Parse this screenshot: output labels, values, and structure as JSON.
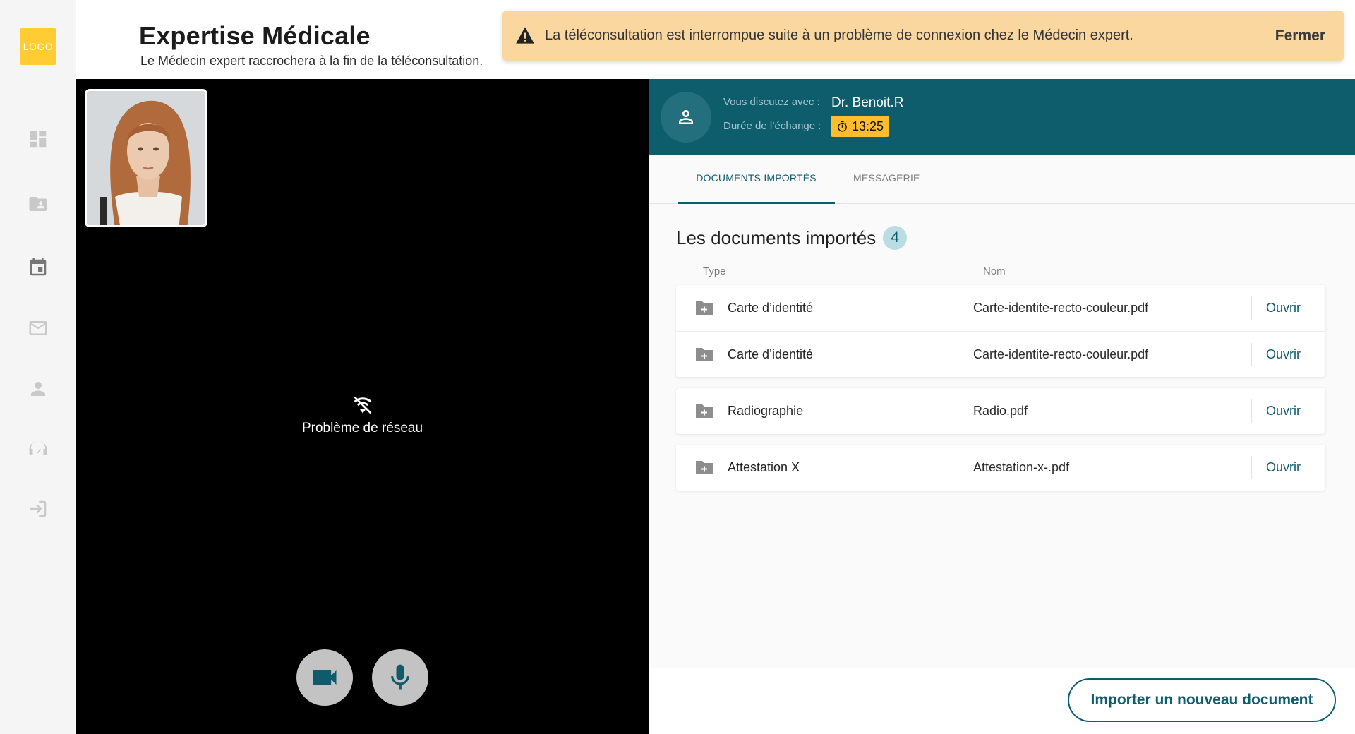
{
  "sidebar": {
    "logo_text": "LOGO",
    "items": [
      {
        "icon": "dashboard-icon"
      },
      {
        "icon": "folder-user-icon"
      },
      {
        "icon": "calendar-icon"
      },
      {
        "icon": "mail-icon"
      },
      {
        "icon": "person-icon"
      },
      {
        "icon": "support-icon"
      },
      {
        "icon": "logout-icon"
      }
    ]
  },
  "header": {
    "title": "Expertise Médicale",
    "subtitle": "Le Médecin expert raccrochera à la fin de la téléconsultation."
  },
  "alert": {
    "message": "La téléconsultation est interrompue suite à un problème de connexion chez le Médecin expert.",
    "close_label": "Fermer",
    "color": "#fbd7a0"
  },
  "video": {
    "status": "Problème de réseau"
  },
  "chat": {
    "with_label": "Vous discutez avec :",
    "doctor": "Dr. Benoit.R",
    "duration_label": "Durée de l’échange :",
    "duration": "13:25"
  },
  "tabs": [
    {
      "label": "DOCUMENTS IMPORTÉS",
      "active": true
    },
    {
      "label": "MESSAGERIE",
      "active": false
    }
  ],
  "documents": {
    "title": "Les documents importés",
    "count": "4",
    "columns": {
      "type": "Type",
      "name": "Nom"
    },
    "open_label": "Ouvrir",
    "groups": [
      [
        {
          "type": "Carte d’identité",
          "name": "Carte-identite-recto-couleur.pdf"
        },
        {
          "type": "Carte d’identité",
          "name": "Carte-identite-recto-couleur.pdf"
        }
      ],
      [
        {
          "type": "Radiographie",
          "name": "Radio.pdf"
        }
      ],
      [
        {
          "type": "Attestation X",
          "name": "Attestation-x-.pdf"
        }
      ]
    ]
  },
  "footer": {
    "import_label": "Importer un nouveau document"
  },
  "colors": {
    "primary": "#0e5d6d",
    "timer": "#fdbd2d",
    "logo": "#ffcc33"
  }
}
